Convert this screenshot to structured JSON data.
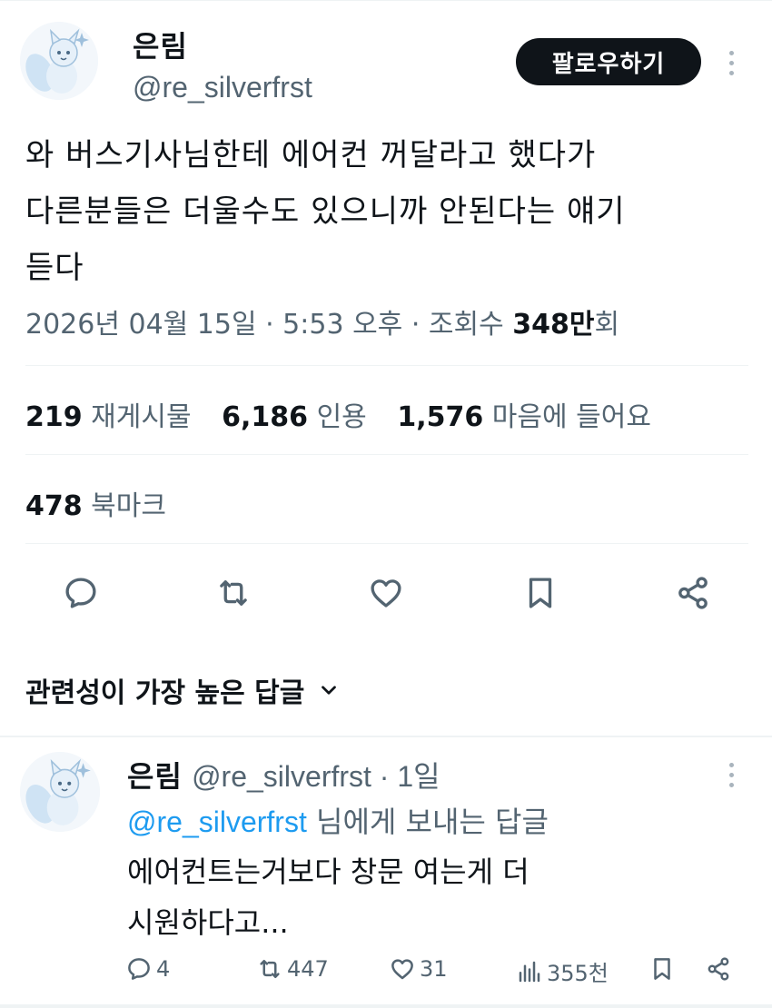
{
  "tweet": {
    "author_name": "은림",
    "author_handle": "@re_silverfrst",
    "follow_label": "팔로우하기",
    "text_lines": [
      "와 버스기사님한테 에어컨 꺼달라고 했다가",
      "다른분들은 더울수도 있으니까 안된다는 얘기",
      "듣다"
    ],
    "meta_prefix": "2026년 04월 15일 · 5:53 오후 · 조회수 ",
    "views_value": "348만",
    "views_suffix": "회"
  },
  "stats": {
    "retweets_count": "219",
    "retweets_label": "재게시물",
    "quotes_count": "6,186",
    "quotes_label": "인용",
    "likes_count": "1,576",
    "likes_label": "마음에 들어요",
    "bookmarks_count": "478",
    "bookmarks_label": "북마크"
  },
  "actions": {
    "icons": [
      "reply-icon",
      "retweet-icon",
      "like-icon",
      "bookmark-icon",
      "share-icon"
    ]
  },
  "sort": {
    "label": "관련성이 가장 높은 답글"
  },
  "reply": {
    "author_name": "은림",
    "author_handle": "@re_silverfrst",
    "time": " · 1일",
    "mention": "@re_silverfrst",
    "reply_to_suffix": " 님에게 보내는 답글",
    "text_lines": [
      "에어컨트는거보다 창문 여는게 더",
      "시원하다고..."
    ],
    "reply_count": "4",
    "retweet_count": "447",
    "like_count": "31",
    "view_count": "355천"
  },
  "colors": {
    "text": "#0f1419",
    "secondary": "#536471",
    "link": "#1d9bf0",
    "follow_bg": "#0f1419"
  }
}
